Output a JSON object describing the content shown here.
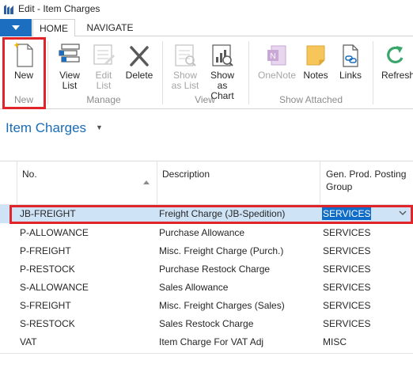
{
  "window": {
    "title": "Edit - Item Charges"
  },
  "tabs": [
    {
      "label": "HOME",
      "active": true
    },
    {
      "label": "NAVIGATE",
      "active": false
    }
  ],
  "ribbon": {
    "new": {
      "label": "New",
      "icon": "new-document-icon"
    },
    "view_list": {
      "label": "View\nList",
      "icon": "view-list-icon"
    },
    "edit_list": {
      "label": "Edit\nList",
      "icon": "edit-list-icon",
      "enabled": false
    },
    "delete": {
      "label": "Delete",
      "icon": "delete-icon"
    },
    "show_as_list": {
      "label": "Show\nas List",
      "icon": "show-as-list-icon",
      "enabled": false
    },
    "show_as_chart": {
      "label": "Show as\nChart",
      "icon": "show-as-chart-icon"
    },
    "onenote": {
      "label": "OneNote",
      "icon": "onenote-icon",
      "enabled": false
    },
    "notes": {
      "label": "Notes",
      "icon": "notes-icon"
    },
    "links": {
      "label": "Links",
      "icon": "links-icon"
    },
    "refresh": {
      "label": "Refresh",
      "icon": "refresh-icon"
    },
    "groups": {
      "new": "New",
      "manage": "Manage",
      "view": "View",
      "show_attached": "Show Attached"
    }
  },
  "page": {
    "title": "Item Charges"
  },
  "table": {
    "columns": {
      "no": "No.",
      "description": "Description",
      "gen_prod_posting_group": "Gen. Prod. Posting\nGroup"
    },
    "rows": [
      {
        "no": "JB-FREIGHT",
        "description": "Freight Charge (JB-Spedition)",
        "group": "SERVICES"
      },
      {
        "no": "P-ALLOWANCE",
        "description": "Purchase Allowance",
        "group": "SERVICES"
      },
      {
        "no": "P-FREIGHT",
        "description": "Misc. Freight Charge (Purch.)",
        "group": "SERVICES"
      },
      {
        "no": "P-RESTOCK",
        "description": "Purchase Restock Charge",
        "group": "SERVICES"
      },
      {
        "no": "S-ALLOWANCE",
        "description": "Sales Allowance",
        "group": "SERVICES"
      },
      {
        "no": "S-FREIGHT",
        "description": "Misc. Freight Charges (Sales)",
        "group": "SERVICES"
      },
      {
        "no": "S-RESTOCK",
        "description": "Sales Restock Charge",
        "group": "SERVICES"
      },
      {
        "no": "VAT",
        "description": "Item Charge For VAT Adj",
        "group": "MISC"
      }
    ]
  },
  "colors": {
    "accent": "#1c6fc0",
    "title_blue": "#1b6cb8",
    "selection": "#cfe3f6",
    "highlight_red": "#e0242a"
  }
}
